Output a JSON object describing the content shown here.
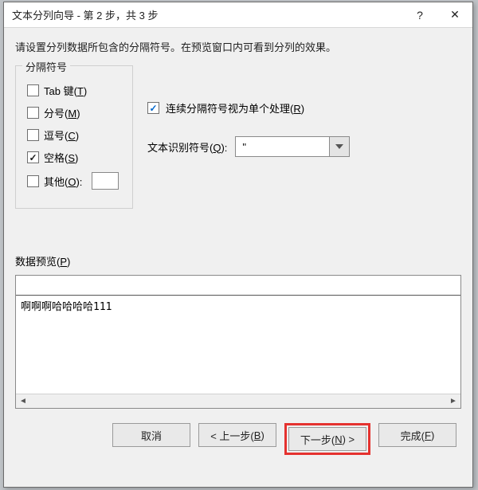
{
  "titlebar": {
    "title": "文本分列向导 - 第 2 步，共 3 步",
    "help": "?",
    "close": "✕"
  },
  "instruction": "请设置分列数据所包含的分隔符号。在预览窗口内可看到分列的效果。",
  "delimiters": {
    "legend": "分隔符号",
    "tab": {
      "label_pre": "Tab 键(",
      "mnemonic": "T",
      "label_post": ")",
      "checked": false
    },
    "semicolon": {
      "label_pre": "分号(",
      "mnemonic": "M",
      "label_post": ")",
      "checked": false
    },
    "comma": {
      "label_pre": "逗号(",
      "mnemonic": "C",
      "label_post": ")",
      "checked": false
    },
    "space": {
      "label_pre": "空格(",
      "mnemonic": "S",
      "label_post": ")",
      "checked": true
    },
    "other": {
      "label_pre": "其他(",
      "mnemonic": "O",
      "label_post": "):",
      "checked": false,
      "value": ""
    }
  },
  "treat_consecutive": {
    "label_pre": "连续分隔符号视为单个处理(",
    "mnemonic": "R",
    "label_post": ")",
    "checked": true
  },
  "text_qualifier": {
    "label_pre": "文本识别符号(",
    "mnemonic": "Q",
    "label_post": "):",
    "value": "\""
  },
  "preview": {
    "label_pre": "数据预览(",
    "mnemonic": "P",
    "label_post": ")",
    "rows": [
      "啊啊啊哈哈哈哈111"
    ]
  },
  "buttons": {
    "cancel": "取消",
    "back_pre": "< 上一步(",
    "back_m": "B",
    "back_post": ")",
    "next_pre": "下一步(",
    "next_m": "N",
    "next_post": ") >",
    "finish_pre": "完成(",
    "finish_m": "F",
    "finish_post": ")"
  }
}
